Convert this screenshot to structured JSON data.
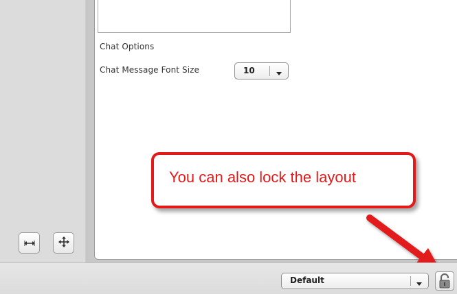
{
  "chat": {
    "section_title": "Chat Options",
    "font_size_label": "Chat Message Font Size",
    "font_size_value": "10"
  },
  "callout": {
    "text": "You can also lock the layout",
    "color": "#e21a1a"
  },
  "footer": {
    "layout_value": "Default"
  },
  "icons": {
    "sidebar_left": "resize-horizontal-icon",
    "sidebar_right": "move-icon",
    "select_arrow": "chevron-down-icon",
    "lock": "unlock-icon"
  }
}
